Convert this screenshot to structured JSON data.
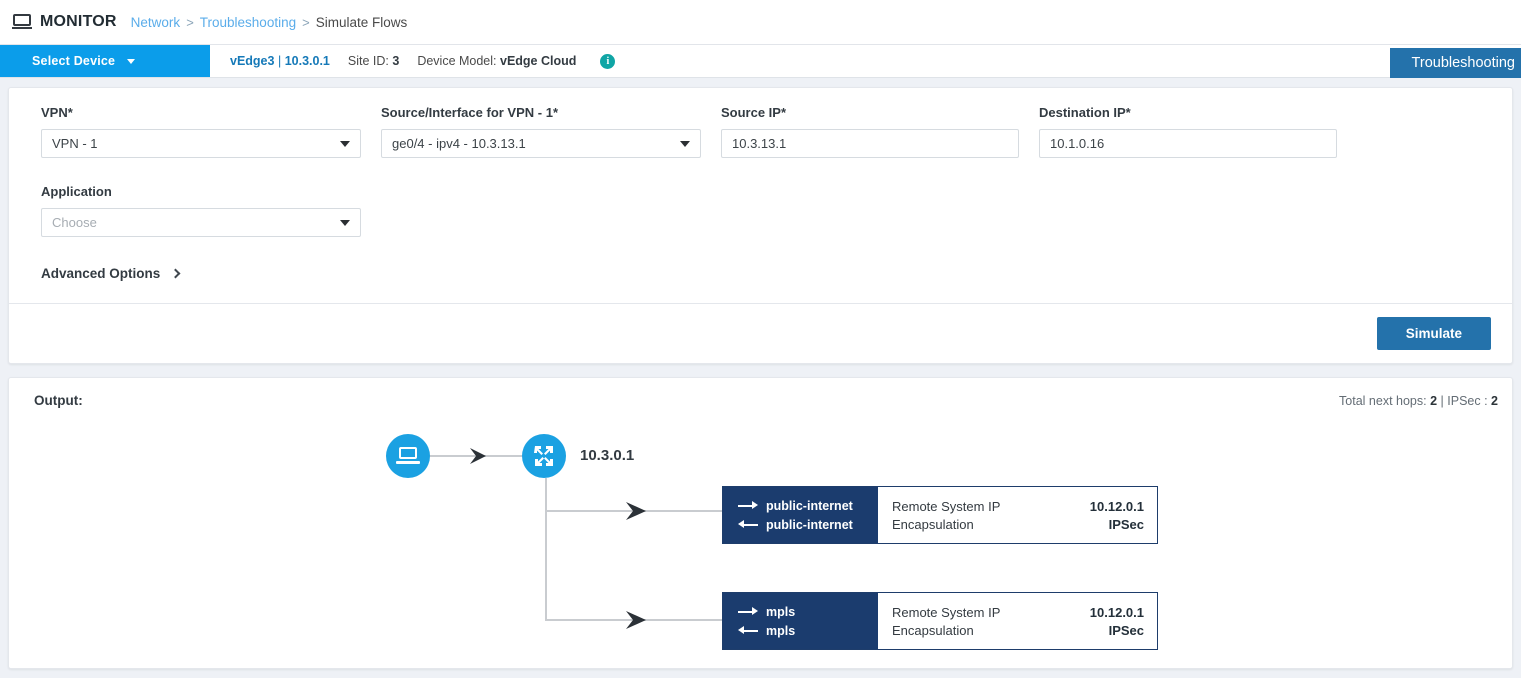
{
  "topbar": {
    "app_title": "MONITOR",
    "monitor_icon": "monitor-icon",
    "breadcrumb": [
      {
        "label": "Network",
        "current": false
      },
      {
        "label": "Troubleshooting",
        "current": false
      },
      {
        "label": "Simulate Flows",
        "current": true
      }
    ],
    "separator": ">"
  },
  "devicebar": {
    "select_device_label": "Select Device",
    "caret_icon": "caret-down-icon",
    "device_name": "vEdge3",
    "device_name_sep": "|",
    "device_ip": "10.3.0.1",
    "site_id_label": "Site ID:",
    "site_id_value": "3",
    "device_model_label": "Device Model:",
    "device_model_value": "vEdge Cloud",
    "info_icon_glyph": "i",
    "troubleshooting_button": "Troubleshooting"
  },
  "form": {
    "fields": [
      {
        "label": "VPN*",
        "value": "VPN - 1",
        "is_placeholder": false,
        "type": "select"
      },
      {
        "label": "Source/Interface for VPN - 1*",
        "value": "ge0/4 - ipv4 - 10.3.13.1",
        "is_placeholder": false,
        "type": "select"
      },
      {
        "label": "Source IP*",
        "value": "10.3.13.1",
        "is_placeholder": false,
        "type": "text"
      },
      {
        "label": "Destination IP*",
        "value": "10.1.0.16",
        "is_placeholder": false,
        "type": "text"
      }
    ],
    "application": {
      "label": "Application",
      "placeholder": "Choose",
      "value": "Choose",
      "type": "select"
    },
    "advanced_options_label": "Advanced Options",
    "advanced_chevron_icon": "chevron-right-icon",
    "simulate_button": "Simulate"
  },
  "output": {
    "label": "Output:",
    "stats_prefix": "Total next hops:",
    "total_next_hops": "2",
    "stats_divider": "|",
    "ipsec_label": "IPSec :",
    "ipsec_count": "2",
    "stats_full": "Total next hops: 2 | IPSec : 2",
    "diagram": {
      "source_icon": "laptop-icon",
      "router_icon": "router-icon",
      "router_ip": "10.3.0.1",
      "hops": [
        {
          "color_tag": "#1b3c6e",
          "tx_arrow_icon": "arrow-right-icon",
          "tx_label": "public-internet",
          "rx_arrow_icon": "arrow-left-icon",
          "rx_label": "public-internet",
          "rows": [
            {
              "key": "Remote System IP",
              "value": "10.12.0.1"
            },
            {
              "key": "Encapsulation",
              "value": "IPSec"
            }
          ]
        },
        {
          "color_tag": "#1b3c6e",
          "tx_arrow_icon": "arrow-right-icon",
          "tx_label": "mpls",
          "rx_arrow_icon": "arrow-left-icon",
          "rx_label": "mpls",
          "rows": [
            {
              "key": "Remote System IP",
              "value": "10.12.0.1"
            },
            {
              "key": "Encapsulation",
              "value": "IPSec"
            }
          ]
        }
      ]
    }
  },
  "colors": {
    "brand_blue": "#0b9dea",
    "button_blue": "#2472ab",
    "node_blue": "#1ba1e2",
    "hop_navy": "#1b3c6e",
    "info_teal": "#10a5a5",
    "page_bg": "#eef1f6",
    "link_blue": "#5badea"
  }
}
